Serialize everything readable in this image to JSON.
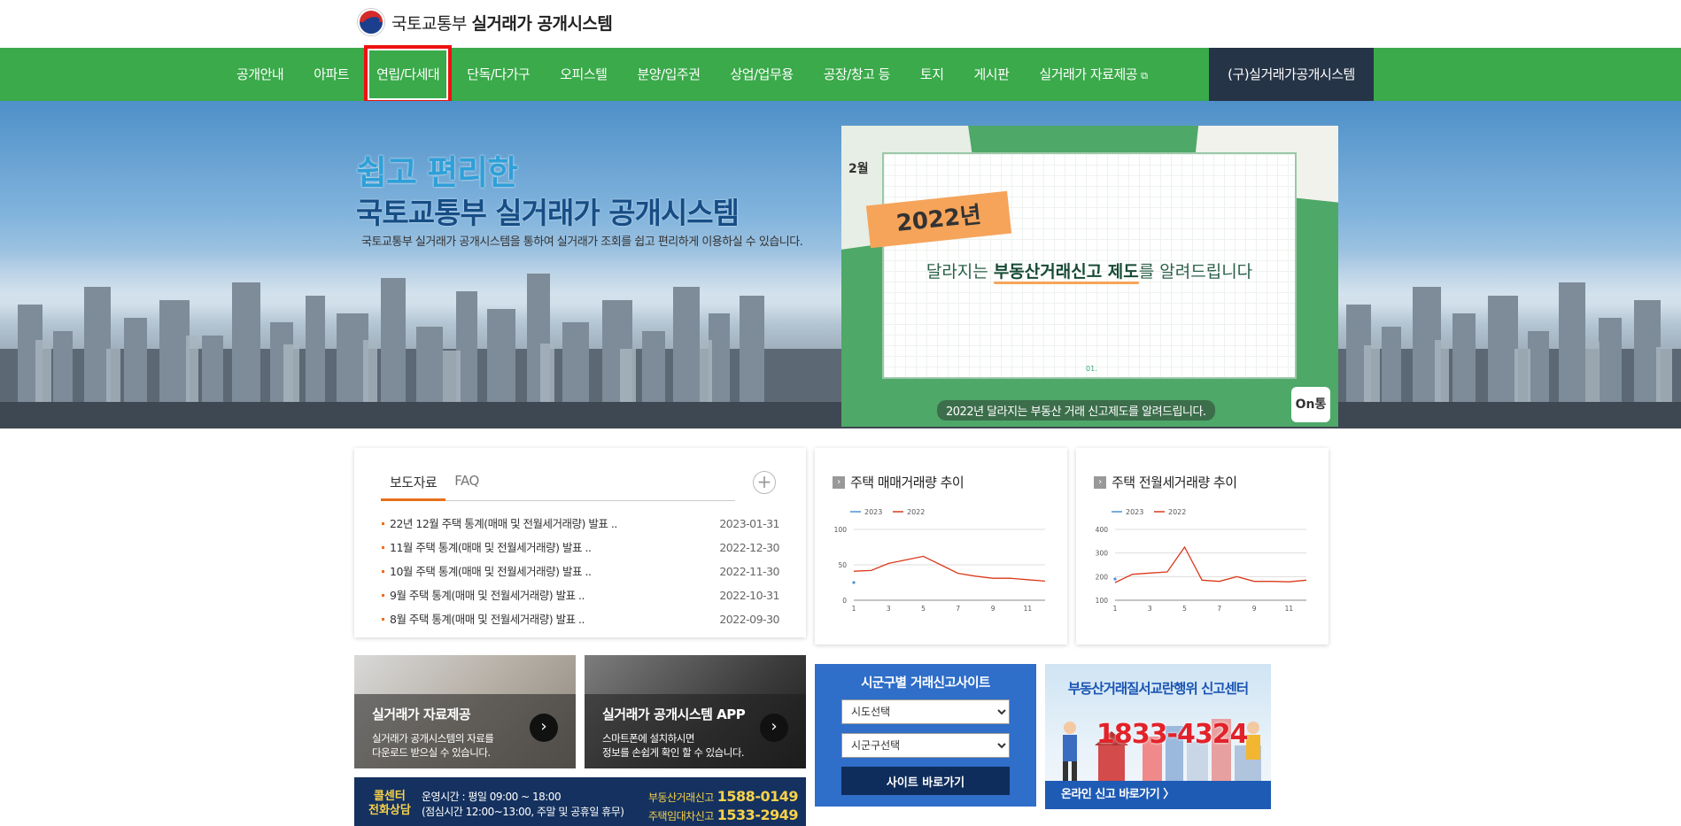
{
  "header": {
    "logo_org": "국토교통부",
    "logo_service": "실거래가 공개시스템"
  },
  "nav": {
    "items": [
      {
        "label": "공개안내"
      },
      {
        "label": "아파트"
      },
      {
        "label": "연립/다세대"
      },
      {
        "label": "단독/다가구"
      },
      {
        "label": "오피스텔"
      },
      {
        "label": "분양/입주권"
      },
      {
        "label": "상업/업무용"
      },
      {
        "label": "공장/창고 등"
      },
      {
        "label": "토지"
      },
      {
        "label": "게시판"
      },
      {
        "label": "실거래가 자료제공"
      }
    ],
    "old_system": "(구)실거래가공개시스템",
    "active_index": 2
  },
  "hero": {
    "title_line1": "쉽고 편리한",
    "title_line2": "국토교통부 실거래가 공개시스템",
    "description": "국토교통부 실거래가 공개시스템을 통하여 실거래가 조회를 쉽고 편리하게 이용하실 수 있습니다.",
    "banner": {
      "month": "2월",
      "year_tag": "2022년",
      "headline_pre": "달라지는 ",
      "headline_bold": "부동산거래신고 제도",
      "headline_post": "를 알려드립니다",
      "page": "01.",
      "caption": "2022년 달라지는 부동산 거래 신고제도를 알려드립니다.",
      "logo": "On통"
    }
  },
  "news": {
    "tabs": [
      "보도자료",
      "FAQ"
    ],
    "more": "+",
    "items": [
      {
        "title": "22년 12월 주택 통계(매매 및 전월세거래량) 발표 ..",
        "date": "2023-01-31"
      },
      {
        "title": "11월 주택 통계(매매 및 전월세거래량) 발표 ..",
        "date": "2022-12-30"
      },
      {
        "title": "10월 주택 통계(매매 및 전월세거래량) 발표 ..",
        "date": "2022-11-30"
      },
      {
        "title": "9월 주택 통계(매매 및 전월세거래량) 발표 ..",
        "date": "2022-10-31"
      },
      {
        "title": "8월 주택 통계(매매 및 전월세거래량) 발표 ..",
        "date": "2022-09-30"
      }
    ]
  },
  "chart_data": [
    {
      "type": "line",
      "title": "주택 매매거래량 추이",
      "x": [
        1,
        2,
        3,
        4,
        5,
        6,
        7,
        8,
        9,
        10,
        11,
        12
      ],
      "xticks": [
        1,
        3,
        5,
        7,
        9,
        11
      ],
      "ylim": [
        0,
        100
      ],
      "yticks": [
        0,
        50,
        100
      ],
      "series": [
        {
          "name": "2023",
          "color": "#4a90d9",
          "values": [
            25
          ]
        },
        {
          "name": "2022",
          "color": "#d93a1b",
          "values": [
            41,
            42,
            52,
            57,
            62,
            50,
            38,
            34,
            31,
            31,
            29,
            27
          ]
        }
      ],
      "legend": "top-left",
      "grid": true
    },
    {
      "type": "line",
      "title": "주택 전월세거래량 추이",
      "x": [
        1,
        2,
        3,
        4,
        5,
        6,
        7,
        8,
        9,
        10,
        11,
        12
      ],
      "xticks": [
        1,
        3,
        5,
        7,
        9,
        11
      ],
      "ylim": [
        100,
        400
      ],
      "yticks": [
        100,
        200,
        300,
        400
      ],
      "series": [
        {
          "name": "2023",
          "color": "#4a90d9",
          "values": [
            190
          ]
        },
        {
          "name": "2022",
          "color": "#d93a1b",
          "values": [
            175,
            210,
            215,
            220,
            325,
            185,
            180,
            200,
            180,
            180,
            178,
            185
          ]
        }
      ],
      "legend": "top-left",
      "grid": true
    }
  ],
  "tiles": [
    {
      "title": "실거래가 자료제공",
      "desc1": "실거래가 공개시스템의 자료를",
      "desc2": "다운로드 받으실 수 있습니다.",
      "go": "›"
    },
    {
      "title": "실거래가 공개시스템 APP",
      "desc1": "스마트폰에 설치하시면",
      "desc2": "정보를 손쉽게 확인 할 수 있습니다.",
      "go": "›"
    }
  ],
  "callcenter": {
    "label1": "콜센터",
    "label2": "전화상담",
    "hours1": "운영시간 : 평일 09:00 ~ 18:00",
    "hours2": "(점심시간 12:00~13:00, 주말 및 공휴일 휴무)",
    "phone1_label": "부동산거래신고",
    "phone1": "1588-0149",
    "phone2_label": "주택임대차신고",
    "phone2": "1533-2949"
  },
  "sitebox": {
    "title": "시군구별 거래신고사이트",
    "sido_placeholder": "시도선택",
    "sigungu_placeholder": "시군구선택",
    "button": "사이트 바로가기"
  },
  "report": {
    "title": "부동산거래질서교란행위 신고센터",
    "phone": "1833-4324",
    "footer": "온라인 신고 바로가기 〉"
  },
  "colors": {
    "nav_green": "#3aaa4a",
    "nav_dark": "#263447",
    "accent_orange": "#e86f1a",
    "highlight_red": "#e11111"
  }
}
